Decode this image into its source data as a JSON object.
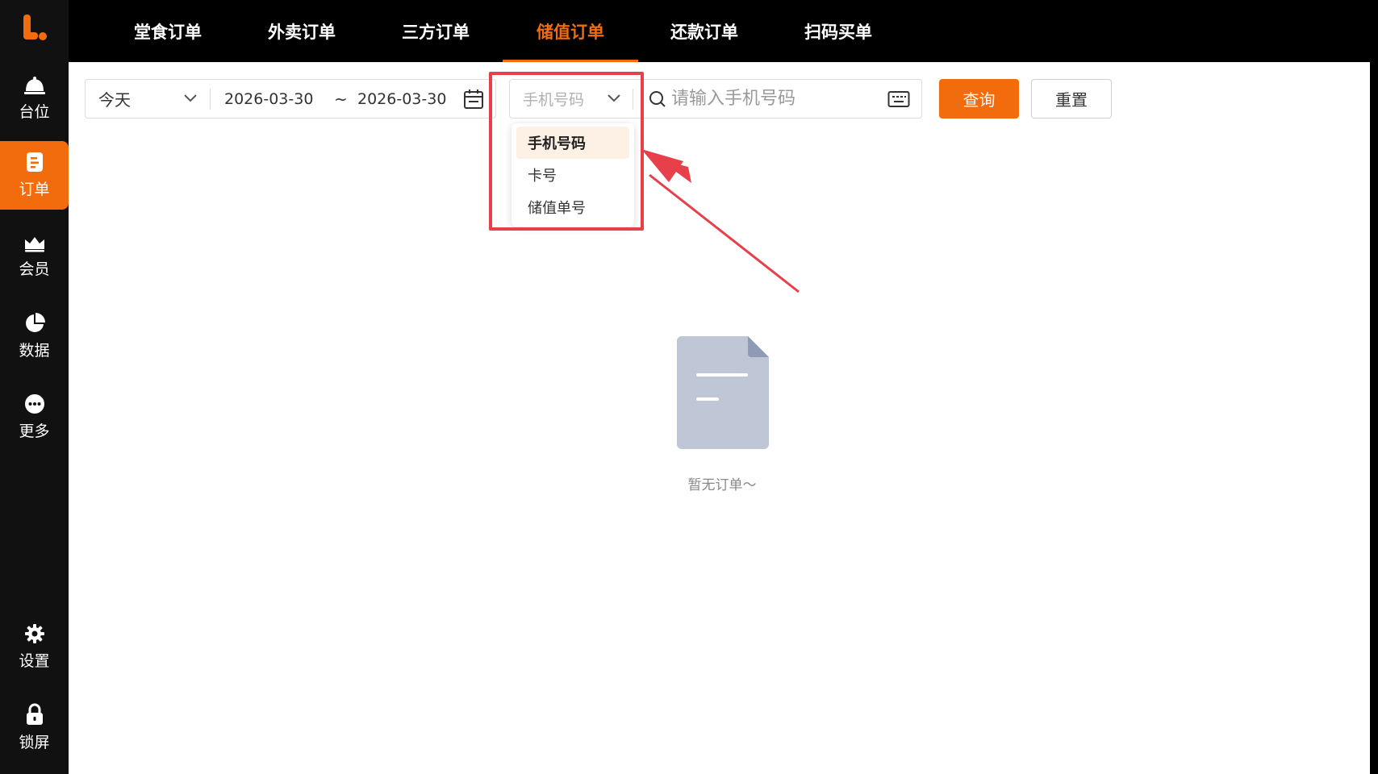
{
  "brand": {
    "accent": "#f26c0d",
    "annotation": "#e8404a"
  },
  "sidebar": {
    "items": [
      {
        "label": "台位",
        "icon": "bell-icon",
        "active": false
      },
      {
        "label": "订单",
        "icon": "order-icon",
        "active": true
      },
      {
        "label": "会员",
        "icon": "crown-icon",
        "active": false
      },
      {
        "label": "数据",
        "icon": "pie-chart-icon",
        "active": false
      },
      {
        "label": "更多",
        "icon": "more-icon",
        "active": false
      },
      {
        "label": "设置",
        "icon": "gear-icon",
        "active": false
      },
      {
        "label": "锁屏",
        "icon": "lock-icon",
        "active": false
      }
    ]
  },
  "topbar": {
    "tabs": [
      {
        "label": "堂食订单",
        "active": false
      },
      {
        "label": "外卖订单",
        "active": false
      },
      {
        "label": "三方订单",
        "active": false
      },
      {
        "label": "储值订单",
        "active": true
      },
      {
        "label": "还款订单",
        "active": false
      },
      {
        "label": "扫码买单",
        "active": false
      }
    ]
  },
  "filters": {
    "range": "今天",
    "start_date": "2026-03-30",
    "separator": "~",
    "end_date": "2026-03-30",
    "search_type": "手机号码",
    "search_placeholder": "请输入手机号码",
    "query_label": "查询",
    "reset_label": "重置"
  },
  "dropdown": {
    "options": [
      {
        "label": "手机号码",
        "selected": true
      },
      {
        "label": "卡号",
        "selected": false
      },
      {
        "label": "储值单号",
        "selected": false
      }
    ]
  },
  "empty": {
    "text": "暂无订单～"
  }
}
